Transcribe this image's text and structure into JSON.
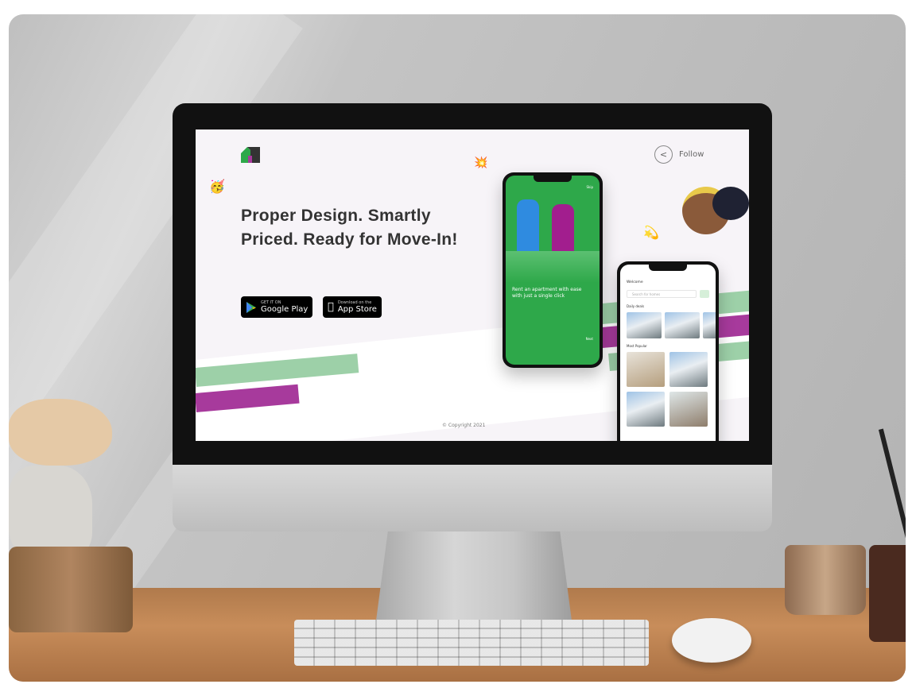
{
  "site": {
    "headline": "Proper Design. Smartly Priced. Ready for Move-In!",
    "follow_label": "Follow",
    "google_play": {
      "small": "GET IT ON",
      "big": "Google Play"
    },
    "app_store": {
      "small": "Download on the",
      "big": "App Store"
    },
    "copyright": "Copyright 2021",
    "colors": {
      "green": "#2ea84a",
      "purple": "#a73a9c",
      "light_green": "#9dd0a8",
      "background": "#f7f4f8"
    }
  },
  "phone_onboarding": {
    "caption": "Rent an apartment with ease with just a single click",
    "skip": "Skip",
    "next": "Next"
  },
  "phone_home": {
    "greeting": "Welcome",
    "search_placeholder": "Search for homes",
    "section_1": "Daily deals",
    "section_2": "Most Popular"
  }
}
